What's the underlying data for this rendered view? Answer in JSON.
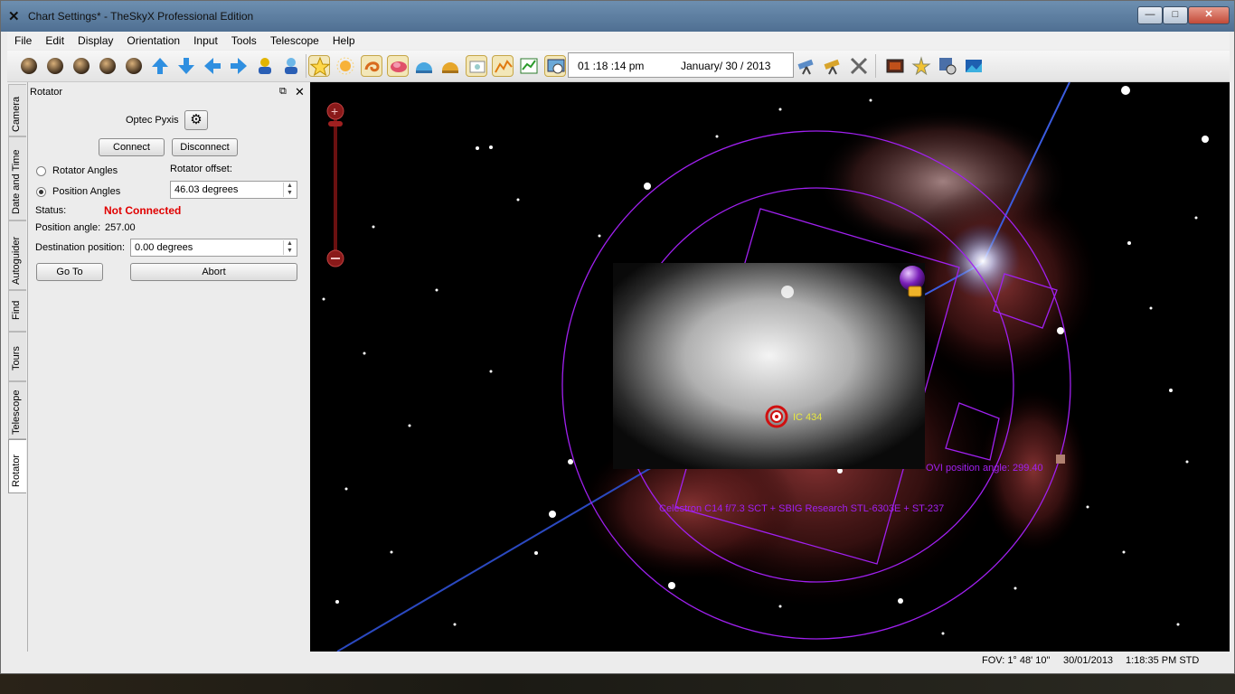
{
  "window": {
    "title": "Chart Settings* - TheSkyX Professional Edition",
    "controls": {
      "minimize": "—",
      "maximize": "□",
      "close": "✕"
    }
  },
  "menu": [
    "File",
    "Edit",
    "Display",
    "Orientation",
    "Input",
    "Tools",
    "Telescope",
    "Help"
  ],
  "toolbar": {
    "time": "01 :18 :14  pm",
    "date": "January/ 30 / 2013"
  },
  "side_tabs": [
    "Camera",
    "Date and Time",
    "Autoguider",
    "Find",
    "Tours",
    "Telescope",
    "Rotator"
  ],
  "rotator": {
    "panel_title": "Rotator",
    "device_name": "Optec Pyxis",
    "connect_label": "Connect",
    "disconnect_label": "Disconnect",
    "radio_rotator_angles": "Rotator Angles",
    "radio_position_angles": "Position Angles",
    "selected_mode": "Position Angles",
    "rotator_offset_label": "Rotator offset:",
    "rotator_offset_value": "46.03 degrees",
    "status_label": "Status:",
    "status_value": "Not Connected",
    "status_color": "#e00000",
    "position_angle_label": "Position angle:",
    "position_angle_value": "257.00",
    "destination_label": "Destination position:",
    "destination_value": "0.00 degrees",
    "goto_label": "Go To",
    "abort_label": "Abort"
  },
  "chart": {
    "object_label": "IC 434",
    "ovi_label": "OVI position angle: 299.40",
    "fov_label": "Celestron C14 f/7.3 SCT + SBIG Research STL-6303E + ST-237",
    "overlay_color": "#a020f0"
  },
  "status_bar": {
    "fov": "FOV: 1° 48' 10\"",
    "date": "30/01/2013",
    "time": "1:18:35 PM STD"
  }
}
